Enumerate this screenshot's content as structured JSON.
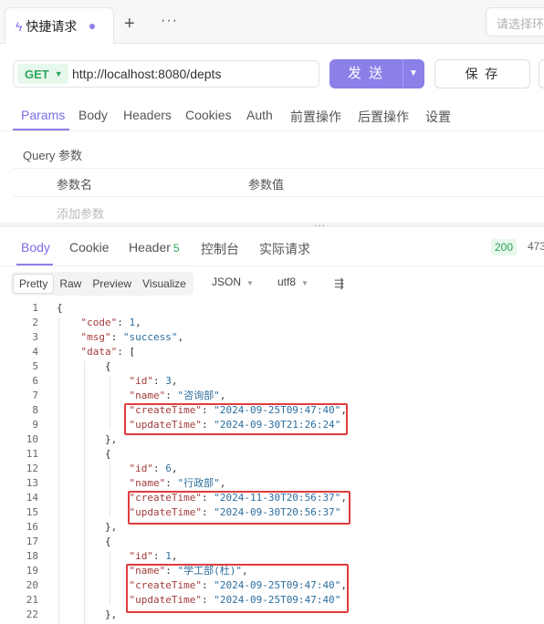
{
  "tab": {
    "title": "快捷请求",
    "add_icon": "+",
    "more_icon": "···"
  },
  "env": {
    "placeholder": "请选择环境"
  },
  "request": {
    "method": "GET",
    "url": "http://localhost:8080/depts",
    "send_label": "发 送",
    "save_label": "保 存"
  },
  "request_tabs": [
    "Params",
    "Body",
    "Headers",
    "Cookies",
    "Auth",
    "前置操作",
    "后置操作",
    "设置"
  ],
  "query": {
    "title": "Query 参数",
    "col_name": "参数名",
    "col_value": "参数值",
    "add_placeholder": "添加参数"
  },
  "response_tabs": {
    "body": "Body",
    "cookie": "Cookie",
    "header": "Header",
    "header_count": "5",
    "console": "控制台",
    "actual": "实际请求"
  },
  "response_status": {
    "code": "200",
    "size": "473"
  },
  "view_modes": [
    "Pretty",
    "Raw",
    "Preview",
    "Visualize"
  ],
  "format": {
    "type": "JSON",
    "encoding": "utf8"
  },
  "colors": {
    "accent": "#8b7fe8",
    "success": "#2ea55c",
    "highlight": "#e03c3c"
  },
  "code_lines": [
    {
      "n": "1",
      "t": "{"
    },
    {
      "n": "2",
      "t": "    \"code\": 1,"
    },
    {
      "n": "3",
      "t": "    \"msg\": \"success\","
    },
    {
      "n": "4",
      "t": "    \"data\": ["
    },
    {
      "n": "5",
      "t": "        {"
    },
    {
      "n": "6",
      "t": "            \"id\": 3,"
    },
    {
      "n": "7",
      "t": "            \"name\": \"咨询部\","
    },
    {
      "n": "8",
      "t": "            \"createTime\": \"2024-09-25T09:47:40\","
    },
    {
      "n": "9",
      "t": "            \"updateTime\": \"2024-09-30T21:26:24\""
    },
    {
      "n": "10",
      "t": "        },"
    },
    {
      "n": "11",
      "t": "        {"
    },
    {
      "n": "12",
      "t": "            \"id\": 6,"
    },
    {
      "n": "13",
      "t": "            \"name\": \"行政部\","
    },
    {
      "n": "14",
      "t": "            \"createTime\": \"2024-11-30T20:56:37\","
    },
    {
      "n": "15",
      "t": "            \"updateTime\": \"2024-09-30T20:56:37\""
    },
    {
      "n": "16",
      "t": "        },"
    },
    {
      "n": "17",
      "t": "        {"
    },
    {
      "n": "18",
      "t": "            \"id\": 1,"
    },
    {
      "n": "19",
      "t": "            \"name\": \"学工部(杜)\","
    },
    {
      "n": "20",
      "t": "            \"createTime\": \"2024-09-25T09:47:40\","
    },
    {
      "n": "21",
      "t": "            \"updateTime\": \"2024-09-25T09:47:40\""
    },
    {
      "n": "22",
      "t": "        },"
    }
  ]
}
